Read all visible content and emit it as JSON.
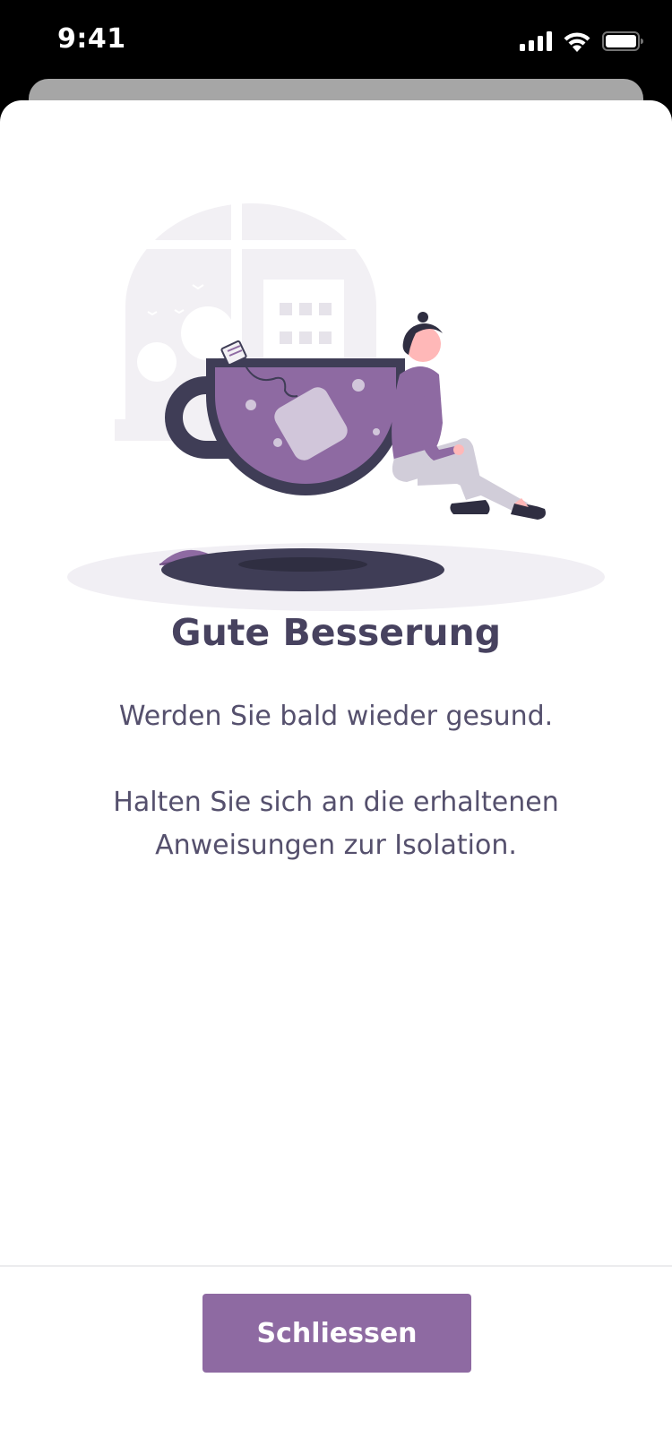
{
  "status_bar": {
    "time": "9:41",
    "icons": [
      "cellular-signal-icon",
      "wifi-icon",
      "battery-icon"
    ]
  },
  "illustration": {
    "subject": "person-sitting-next-to-tea-cup-illustration",
    "colors": {
      "accent": "#8e6aa2",
      "dark": "#3f3d56",
      "light_background": "#f2f0f4",
      "skin": "#ffb8b8",
      "pants": "#d1cdd9"
    }
  },
  "content": {
    "title": "Gute Besserung",
    "line_1": "Werden Sie bald wieder gesund.",
    "line_2": "Halten Sie sich an die erhaltenen Anweisungen zur Isolation."
  },
  "footer": {
    "close_label": "Schliessen"
  },
  "colors": {
    "accent": "#8e6aa2",
    "title_text": "#47425f",
    "body_text": "#55506d"
  }
}
